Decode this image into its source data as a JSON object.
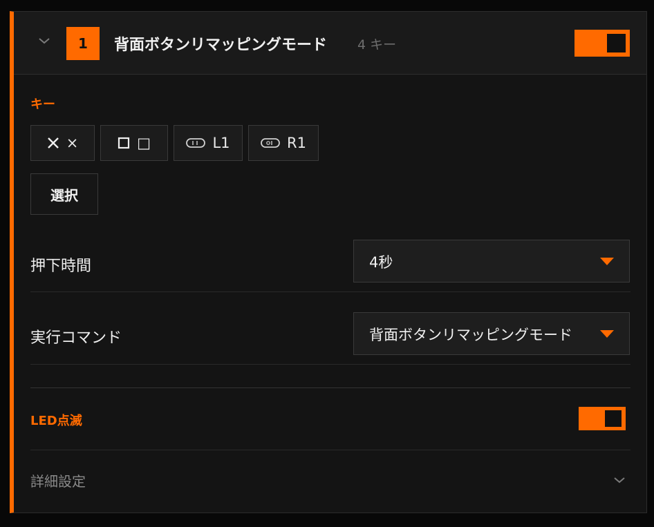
{
  "mode": {
    "number": "1",
    "title": "背面ボタンリマッピングモード",
    "key_count": "4 キー",
    "enabled": true
  },
  "keys_section": {
    "label": "キー",
    "chips": [
      {
        "icon": "cross-icon",
        "text": "×"
      },
      {
        "icon": "square-icon",
        "text": "□"
      },
      {
        "icon": "l1-bumper-icon",
        "text": "L1"
      },
      {
        "icon": "r1-bumper-icon",
        "text": "R1"
      }
    ],
    "select_label": "選択"
  },
  "press_time": {
    "label": "押下時間",
    "value": "4秒"
  },
  "command": {
    "label": "実行コマンド",
    "value": "背面ボタンリマッピングモード"
  },
  "led": {
    "label": "LED点滅",
    "enabled": true
  },
  "advanced": {
    "label": "詳細設定"
  },
  "colors": {
    "accent": "#ff6a00",
    "background": "#141414",
    "muted_text": "#8a8a8a"
  }
}
